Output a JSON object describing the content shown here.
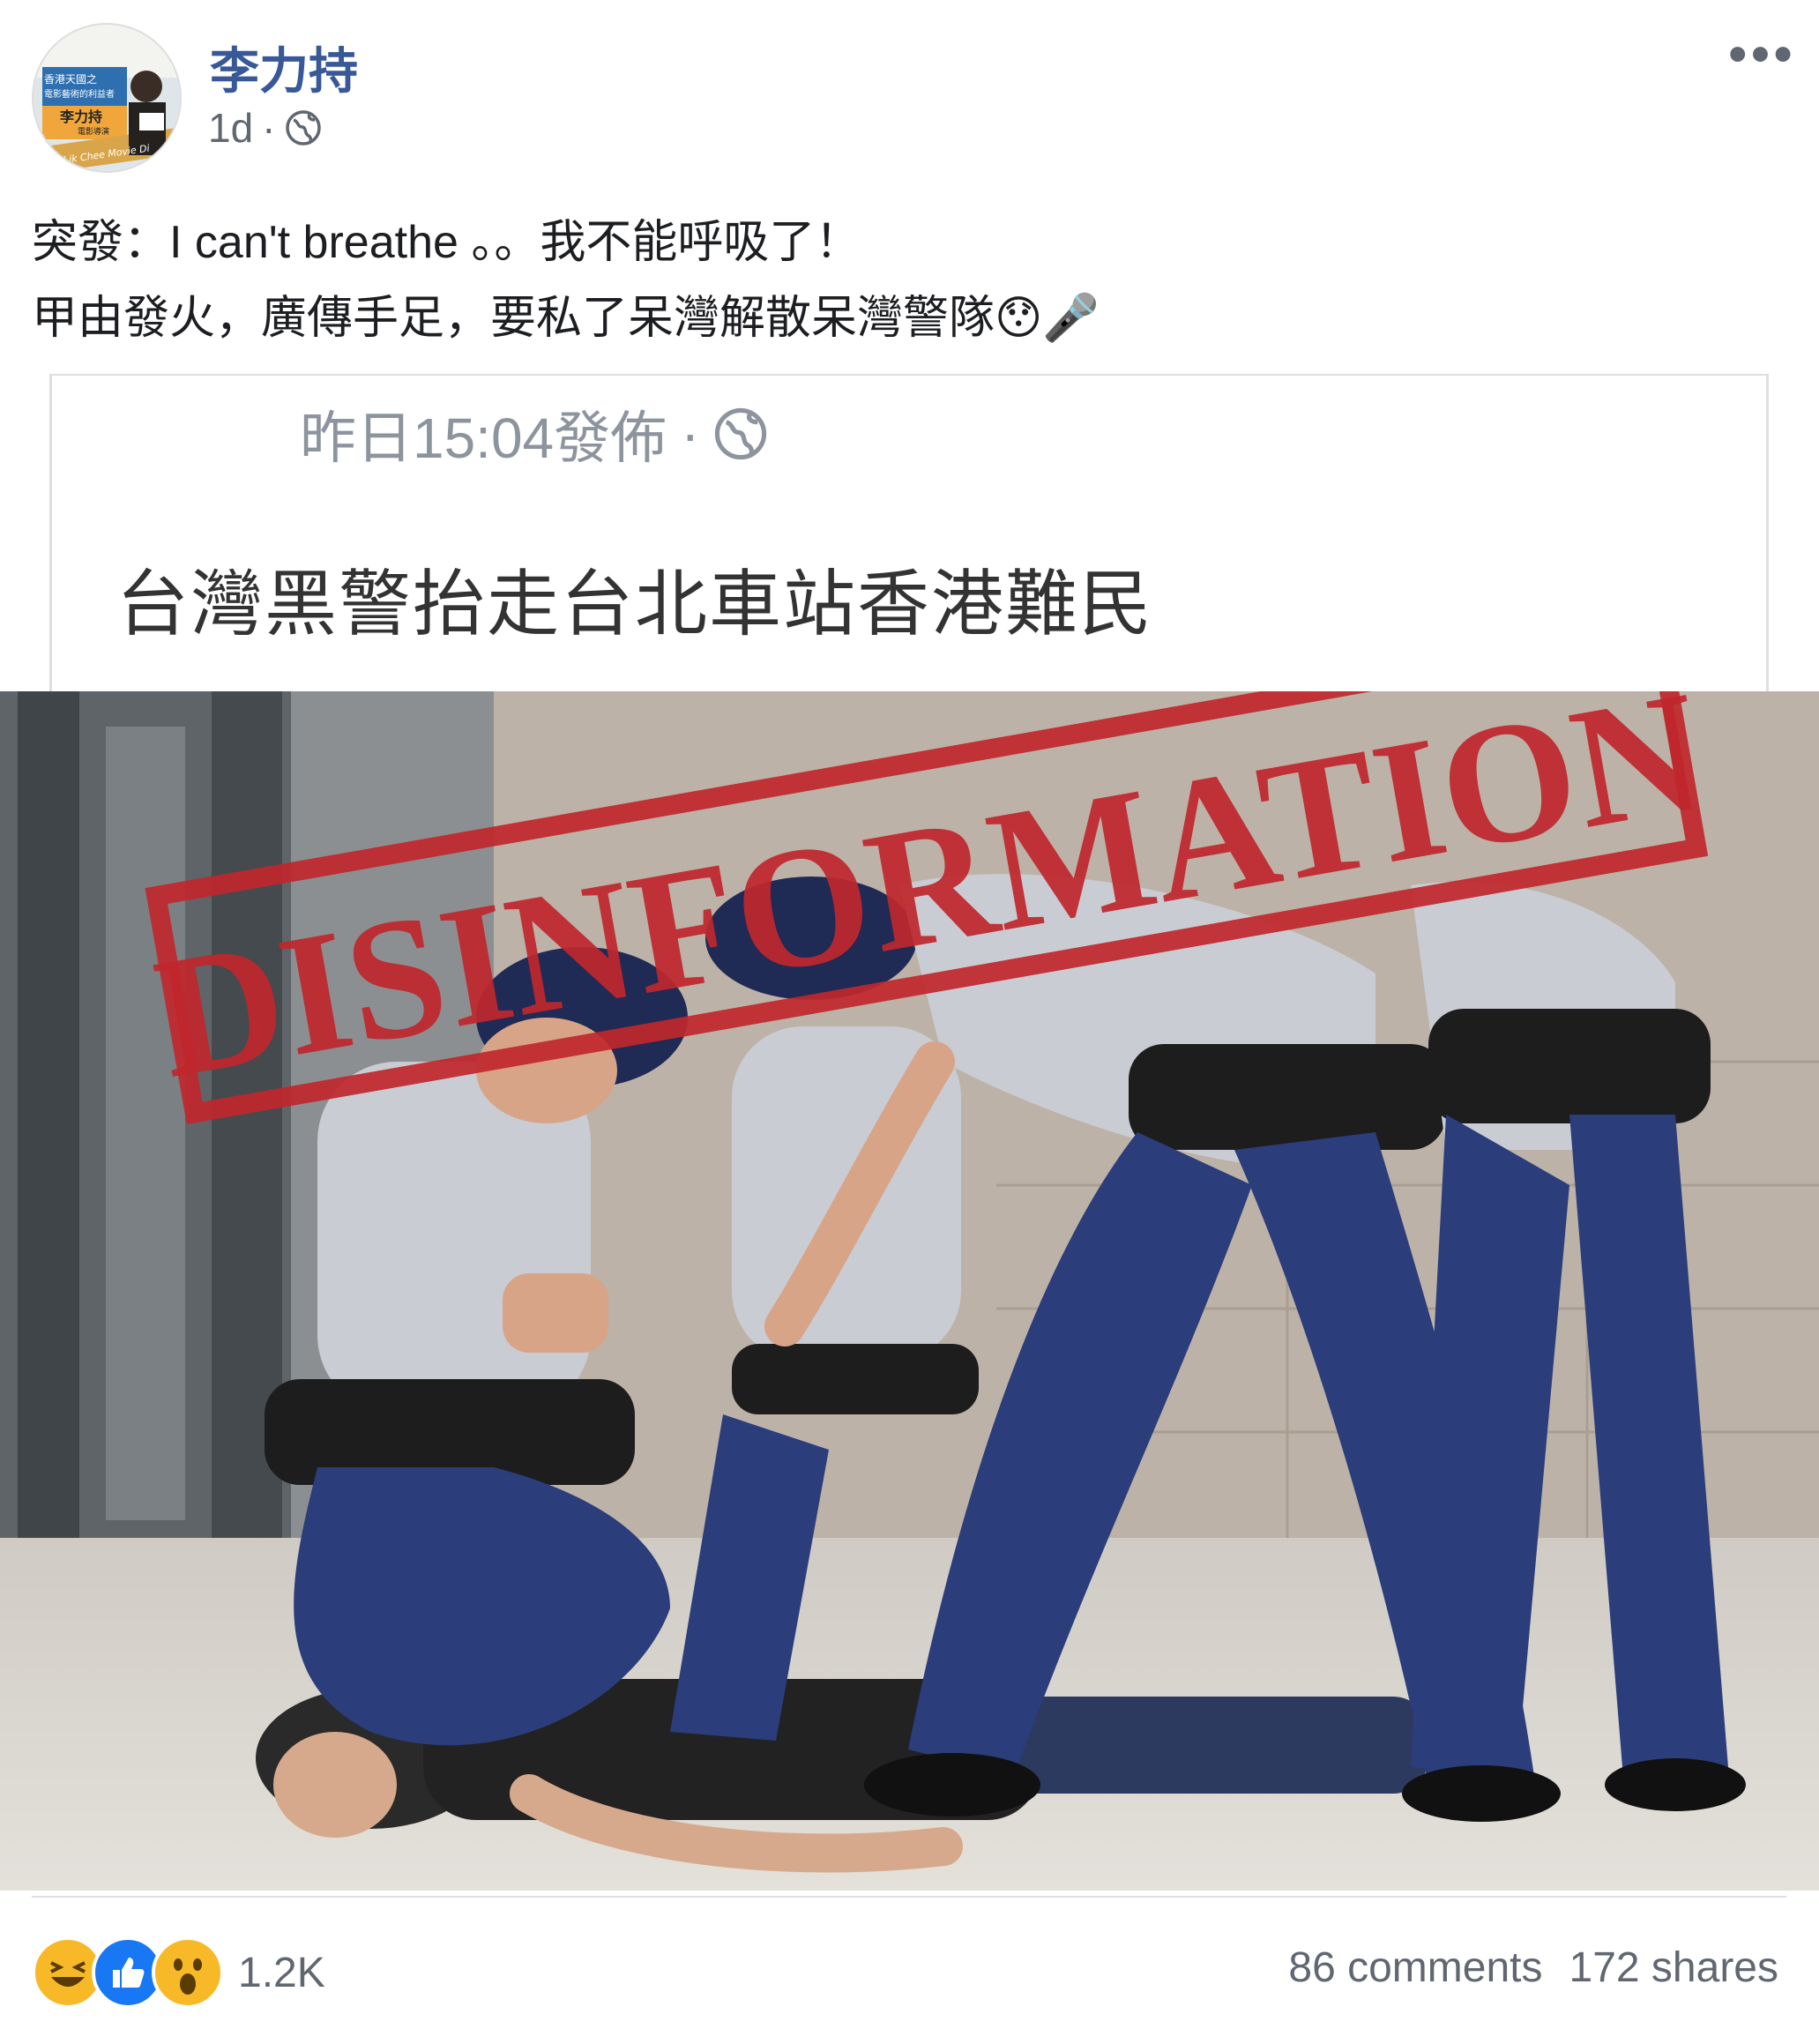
{
  "post": {
    "author": "李力持",
    "time": "1d",
    "separator": "·",
    "privacy_icon": "globe-icon",
    "more_icon": "more-options-icon",
    "more_label": "•••",
    "text_line_1": "突發：I can't breathe 。。我不能呼吸了！",
    "text_line_2": "甲由發火，廣傳手足，要私了呆灣解散呆灣警隊😯🎤"
  },
  "avatar": {
    "line_1": "香港天國之",
    "line_2": "電影藝術的利益者",
    "name_tag": "李力持",
    "tag_sub": "電影導演",
    "ribbon": "Lee Lik Chee Movie Di"
  },
  "shared_card": {
    "timestamp": "昨日15:04發佈",
    "dot": "·",
    "privacy_icon": "globe-icon",
    "title": "台灣黑警抬走台北車站香港難民"
  },
  "photo": {
    "stamp_text": "DISINFORMATION",
    "stamp_color": "#c0272d",
    "uniform_shirt": "#c9ccd3",
    "uniform_pants": "#2b3d7a"
  },
  "reactions": {
    "icons": [
      "haha-icon",
      "like-icon",
      "wow-icon"
    ],
    "count": "1.2K",
    "comments": "86 comments",
    "shares": "172 shares"
  }
}
